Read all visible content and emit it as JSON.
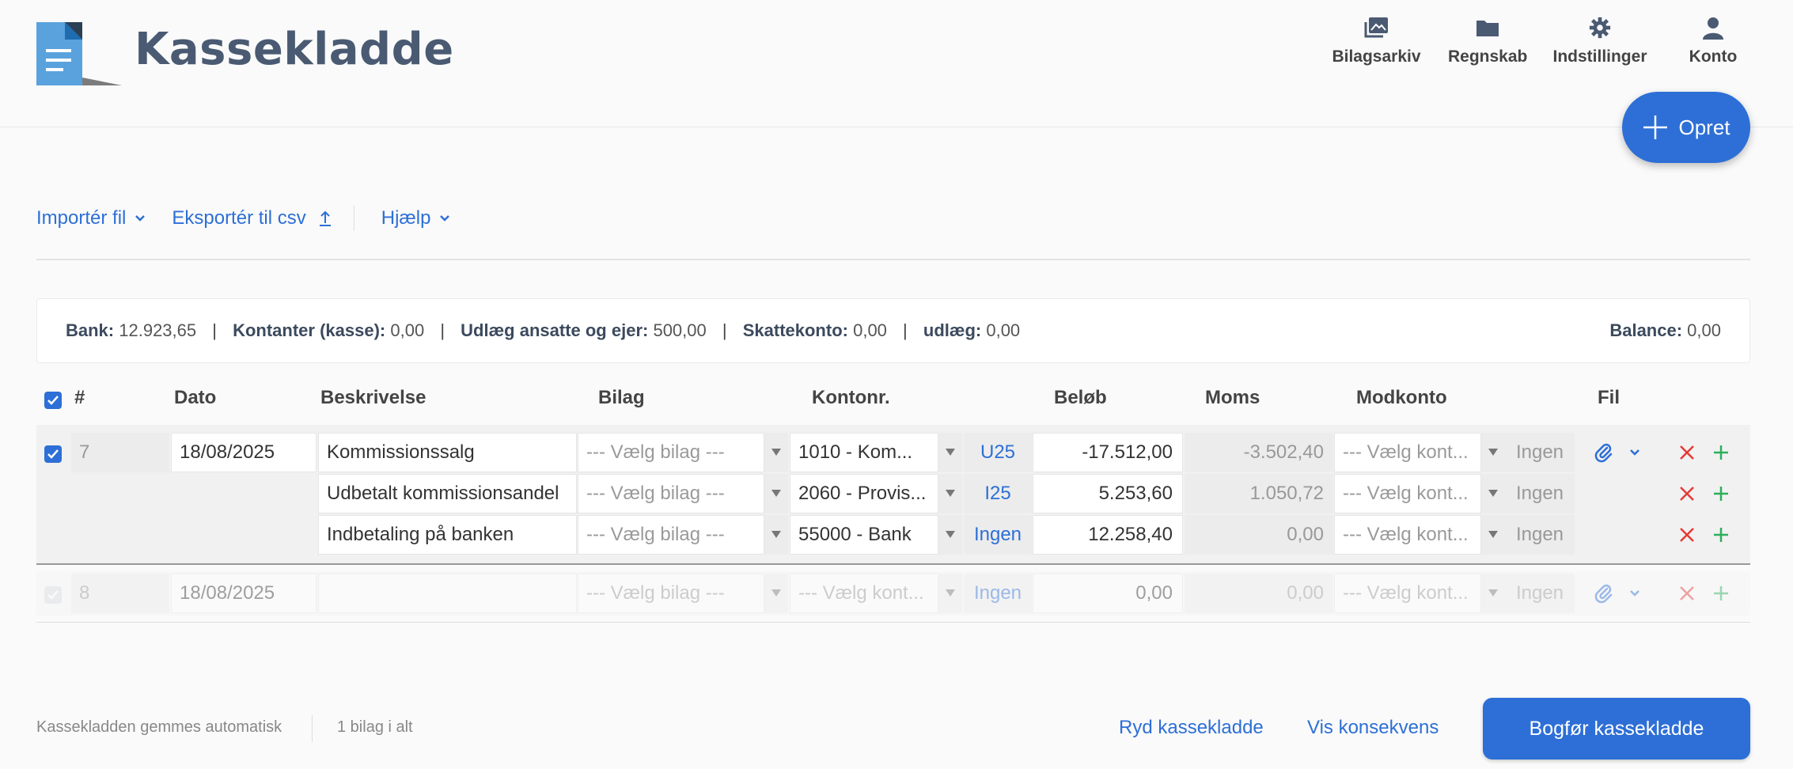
{
  "app": {
    "title": "Kassekladde"
  },
  "nav": [
    {
      "label": "Bilagsarkiv",
      "icon": "image-archive-icon"
    },
    {
      "label": "Regnskab",
      "icon": "folder-icon"
    },
    {
      "label": "Indstillinger",
      "icon": "gear-icon"
    },
    {
      "label": "Konto",
      "icon": "user-icon"
    }
  ],
  "create_button": {
    "label": "Opret"
  },
  "toolbar": {
    "import": "Importér fil",
    "export": "Eksportér til csv",
    "help": "Hjælp"
  },
  "summary": {
    "bank_label": "Bank:",
    "bank_value": "12.923,65",
    "cash_label": "Kontanter (kasse):",
    "cash_value": "0,00",
    "outlay_label": "Udlæg ansatte og ejer:",
    "outlay_value": "500,00",
    "tax_label": "Skattekonto:",
    "tax_value": "0,00",
    "udlaeg_label": "udlæg:",
    "udlaeg_value": "0,00",
    "balance_label": "Balance:",
    "balance_value": "0,00",
    "separator": "|"
  },
  "columns": {
    "num": "#",
    "date": "Dato",
    "description": "Beskrivelse",
    "voucher": "Bilag",
    "account": "Kontonr.",
    "amount": "Beløb",
    "vat": "Moms",
    "counter": "Modkonto",
    "file": "Fil"
  },
  "groups": [
    {
      "number": "7",
      "date": "18/08/2025",
      "lines": [
        {
          "description": "Kommissionssalg",
          "voucher": "--- Vælg bilag ---",
          "account": "1010 - Kom...",
          "vat_code": "U25",
          "amount": "-17.512,00",
          "vat": "-3.502,40",
          "counter": "--- Vælg kont...",
          "counter_vat": "Ingen"
        },
        {
          "description": "Udbetalt kommissionsandel",
          "voucher": "--- Vælg bilag ---",
          "account": "2060 - Provis...",
          "vat_code": "I25",
          "amount": "5.253,60",
          "vat": "1.050,72",
          "counter": "--- Vælg kont...",
          "counter_vat": "Ingen"
        },
        {
          "description": "Indbetaling på banken",
          "voucher": "--- Vælg bilag ---",
          "account": "55000 - Bank",
          "vat_code": "Ingen",
          "amount": "12.258,40",
          "vat": "0,00",
          "counter": "--- Vælg kont...",
          "counter_vat": "Ingen"
        }
      ]
    },
    {
      "number": "8",
      "date": "18/08/2025",
      "lines": [
        {
          "description": "",
          "voucher": "--- Vælg bilag ---",
          "account": "--- Vælg kont...",
          "vat_code": "Ingen",
          "amount": "0,00",
          "vat": "0,00",
          "counter": "--- Vælg kont...",
          "counter_vat": "Ingen"
        }
      ]
    }
  ],
  "footer": {
    "autosave": "Kassekladden gemmes automatisk",
    "count": "1 bilag i alt",
    "clear": "Ryd kassekladde",
    "consequence": "Vis konsekvens",
    "post": "Bogfør kassekladde"
  },
  "colors": {
    "accent": "#2d6fd6",
    "danger": "#e53935",
    "success": "#2eae5a",
    "title": "#4a5a72"
  }
}
